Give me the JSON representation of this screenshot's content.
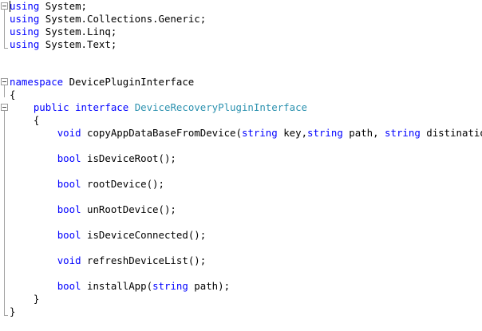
{
  "usings": [
    {
      "keyword": "using",
      "name": "System;"
    },
    {
      "keyword": "using",
      "name": "System.Collections.Generic;"
    },
    {
      "keyword": "using",
      "name": "System.Linq;"
    },
    {
      "keyword": "using",
      "name": "System.Text;"
    }
  ],
  "namespace": {
    "keyword": "namespace",
    "name": "DevicePluginInterface",
    "open_brace": "{",
    "close_brace": "}"
  },
  "interface": {
    "modifier": "public",
    "keyword": "interface",
    "name": "DeviceRecoveryPluginInterface",
    "open_brace": "{",
    "close_brace": "}"
  },
  "methods": [
    {
      "return_type": "void",
      "name": "copyAppDataBaseFromDevice(",
      "p1_type": "string",
      "p1_name": " key,",
      "p2_type": "string",
      "p2_name": " path, ",
      "p3_type": "string",
      "p3_name": " distination);"
    },
    {
      "return_type": "bool",
      "signature": "isDeviceRoot();"
    },
    {
      "return_type": "bool",
      "signature": "rootDevice();"
    },
    {
      "return_type": "bool",
      "signature": "unRootDevice();"
    },
    {
      "return_type": "bool",
      "signature": "isDeviceConnected();"
    },
    {
      "return_type": "void",
      "signature": "refreshDeviceList();"
    },
    {
      "return_type": "bool",
      "name": "installApp(",
      "p1_type": "string",
      "p1_name": " path);"
    }
  ],
  "colors": {
    "keyword": "#0000ff",
    "type_name": "#2b91af",
    "text": "#000000",
    "background": "#ffffff"
  }
}
